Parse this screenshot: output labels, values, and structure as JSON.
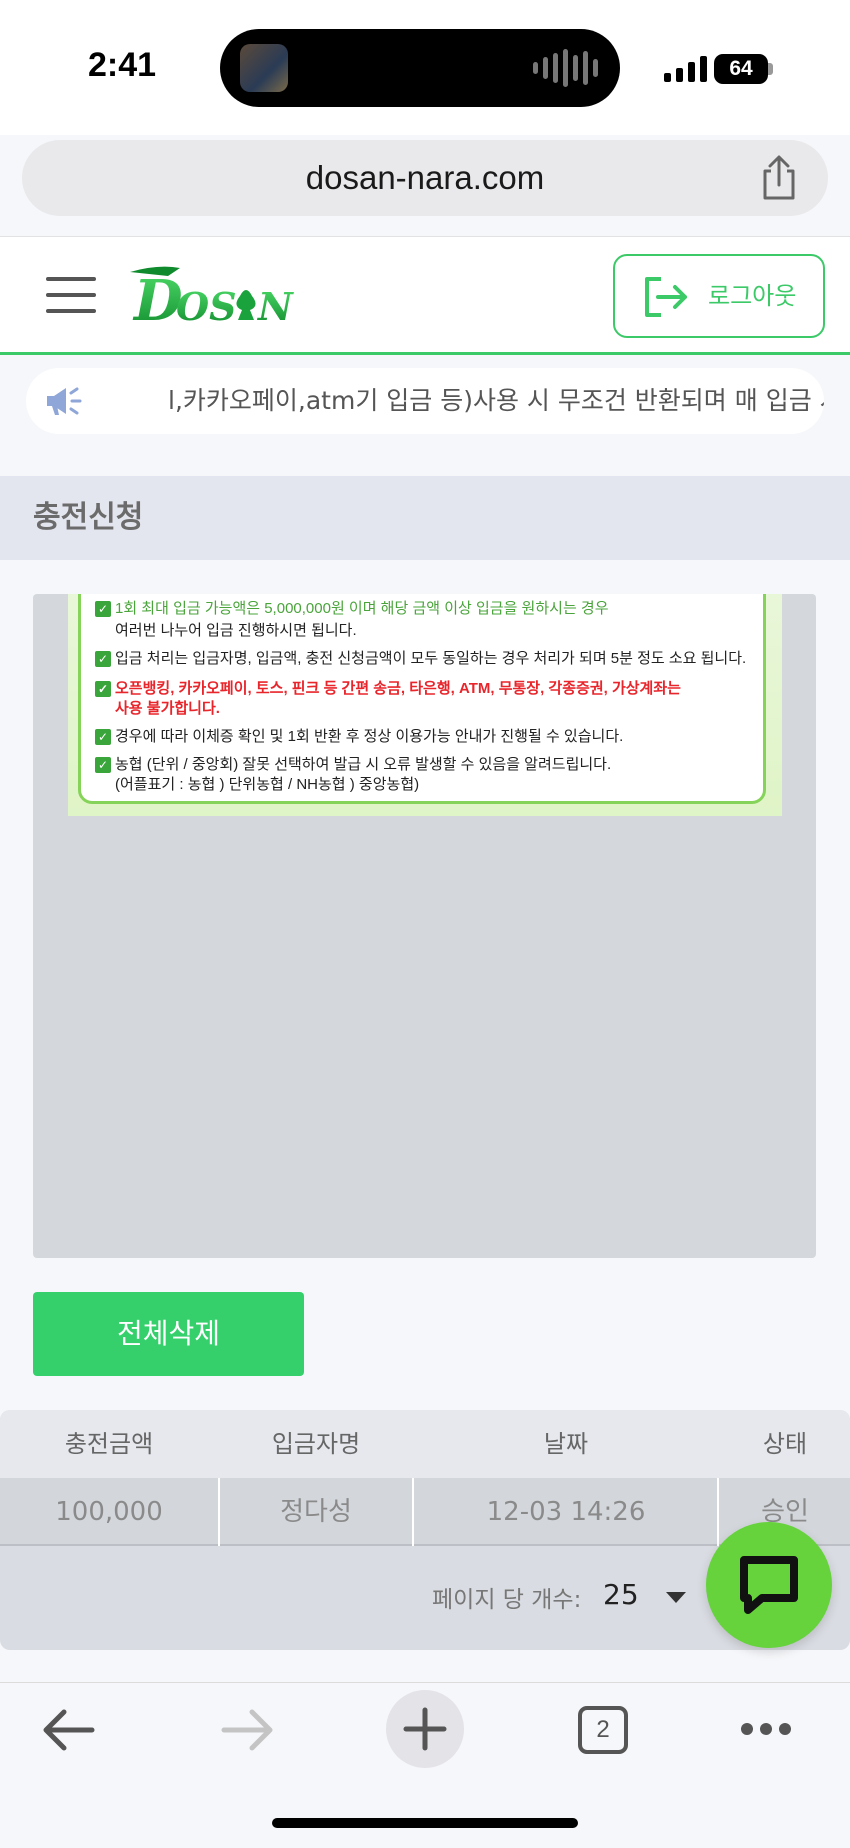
{
  "status_bar": {
    "time": "2:41",
    "battery": "64"
  },
  "browser": {
    "url": "dosan-nara.com",
    "tabs_count": "2"
  },
  "header": {
    "logo_text": "DOSAN",
    "logout_label": "로그아웃"
  },
  "notice": {
    "text": "l,카카오페이,atm기 입금 등)사용 시 무조건 반환되며 매 입금 시"
  },
  "section": {
    "title": "충전신청"
  },
  "notice_image": {
    "lines": [
      "1회 최대 입금 가능액은 5,000,000원 이며 해당 금액 이상 입금을 원하시는 경우",
      "여러번 나누어 입금 진행하시면 됩니다.",
      "입금 처리는 입금자명, 입금액, 충전 신청금액이 모두 동일하는 경우 처리가 되며 5분 정도 소요 됩니다.",
      "오픈뱅킹, 카카오페이, 토스, 핀크 등 간편 송금, 타은행, ATM, 무통장, 각종증권, 가상계좌는",
      "사용 불가합니다.",
      "경우에 따라 이체증 확인 및 1회 반환 후 정상 이용가능 안내가 진행될 수 있습니다.",
      "농협 (단위 / 중앙회) 잘못 선택하여 발급 시 오류 발생할 수 있음을 알려드립니다.",
      "(어플표기 : 농협 ) 단위농협 / NH농협 ) 중앙농협)"
    ]
  },
  "actions": {
    "delete_all": "전체삭제"
  },
  "table": {
    "headers": [
      "충전금액",
      "입금자명",
      "날짜",
      "상태"
    ],
    "rows": [
      [
        "100,000",
        "정다성",
        "12-03 14:26",
        "승인"
      ]
    ]
  },
  "pager": {
    "label": "페이지 당 개수:",
    "value": "25"
  },
  "colors": {
    "accent": "#3cc968",
    "button": "#35d06c",
    "chat": "#66d23c"
  }
}
